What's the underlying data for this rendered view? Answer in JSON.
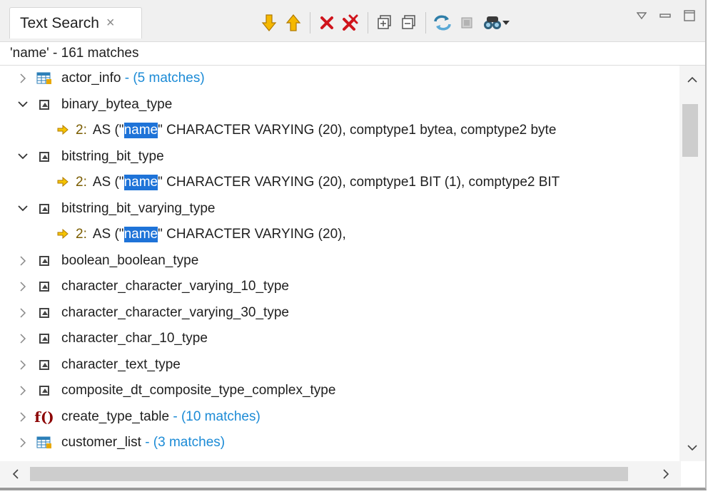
{
  "tab": {
    "title": "Text Search",
    "close_glyph": "×"
  },
  "toolbar": {
    "next_icon": "arrow-down-icon",
    "prev_icon": "arrow-up-icon",
    "remove_icon": "remove-icon",
    "remove_all_icon": "remove-all-icon",
    "expand_icon": "expand-all-icon",
    "collapse_icon": "collapse-all-icon",
    "refresh_icon": "refresh-icon",
    "stop_icon": "stop-icon",
    "history_icon": "search-history-icon"
  },
  "status": {
    "text": "'name' - 161 matches"
  },
  "tree": [
    {
      "kind": "table",
      "name": "actor_info",
      "matches": "- (5 matches)",
      "expanded": false
    },
    {
      "kind": "type",
      "name": "binary_bytea_type",
      "matches": "",
      "expanded": true,
      "children": [
        {
          "line": "2:",
          "pre": "AS (\"",
          "hit": "name",
          "post": "\" CHARACTER VARYING (20), comptype1 bytea, comptype2 byte"
        }
      ]
    },
    {
      "kind": "type",
      "name": "bitstring_bit_type",
      "matches": "",
      "expanded": true,
      "children": [
        {
          "line": "2:",
          "pre": "AS (\"",
          "hit": "name",
          "post": "\" CHARACTER VARYING (20), comptype1 BIT (1), comptype2 BIT"
        }
      ]
    },
    {
      "kind": "type",
      "name": "bitstring_bit_varying_type",
      "matches": "",
      "expanded": true,
      "children": [
        {
          "line": "2:",
          "pre": "AS (\"",
          "hit": "name",
          "post": "\" CHARACTER VARYING (20),"
        }
      ]
    },
    {
      "kind": "type",
      "name": "boolean_boolean_type",
      "matches": "",
      "expanded": false
    },
    {
      "kind": "type",
      "name": "character_character_varying_10_type",
      "matches": "",
      "expanded": false
    },
    {
      "kind": "type",
      "name": "character_character_varying_30_type",
      "matches": "",
      "expanded": false
    },
    {
      "kind": "type",
      "name": "character_char_10_type",
      "matches": "",
      "expanded": false
    },
    {
      "kind": "type",
      "name": "character_text_type",
      "matches": "",
      "expanded": false
    },
    {
      "kind": "type",
      "name": "composite_dt_composite_type_complex_type",
      "matches": "",
      "expanded": false
    },
    {
      "kind": "function",
      "name": "create_type_table",
      "matches": "- (10 matches)",
      "expanded": false
    },
    {
      "kind": "table",
      "name": "customer_list",
      "matches": "- (3 matches)",
      "expanded": false
    }
  ],
  "colors": {
    "highlight": "#1e73d8",
    "match_count": "#1c8bd6",
    "function": "#8b0000"
  }
}
